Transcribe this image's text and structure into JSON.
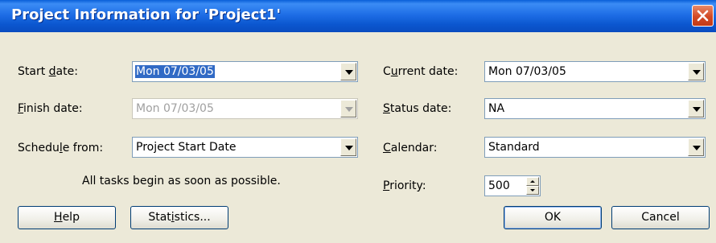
{
  "window": {
    "title": "Project Information for 'Project1'",
    "close_icon": "close-icon"
  },
  "left": {
    "start_date": {
      "label_pre": "Start ",
      "label_key": "d",
      "label_post": "ate:",
      "value": "Mon 07/03/05"
    },
    "finish_date": {
      "label_pre": "",
      "label_key": "F",
      "label_post": "inish date:",
      "value": "Mon 07/03/05",
      "disabled": true
    },
    "schedule_from": {
      "label_pre": "Schedu",
      "label_key": "l",
      "label_post": "e from:",
      "value": "Project Start Date"
    },
    "note": "All tasks begin as soon as possible."
  },
  "right": {
    "current_date": {
      "label_pre": "C",
      "label_key": "u",
      "label_post": "rrent date:",
      "value": "Mon 07/03/05"
    },
    "status_date": {
      "label_pre": "",
      "label_key": "S",
      "label_post": "tatus date:",
      "value": "NA"
    },
    "calendar": {
      "label_pre": "",
      "label_key": "C",
      "label_post": "alendar:",
      "value": "Standard"
    },
    "priority": {
      "label_pre": "",
      "label_key": "P",
      "label_post": "riority:",
      "value": "500"
    }
  },
  "buttons": {
    "help": {
      "pre": "",
      "key": "H",
      "post": "elp"
    },
    "statistics": {
      "pre": "Stat",
      "key": "i",
      "post": "stics..."
    },
    "ok": "OK",
    "cancel": "Cancel"
  },
  "colors": {
    "titlebar": "#0b57d0",
    "dialog_bg": "#ece9d8",
    "selection": "#316ac5",
    "close": "#d24a25"
  }
}
